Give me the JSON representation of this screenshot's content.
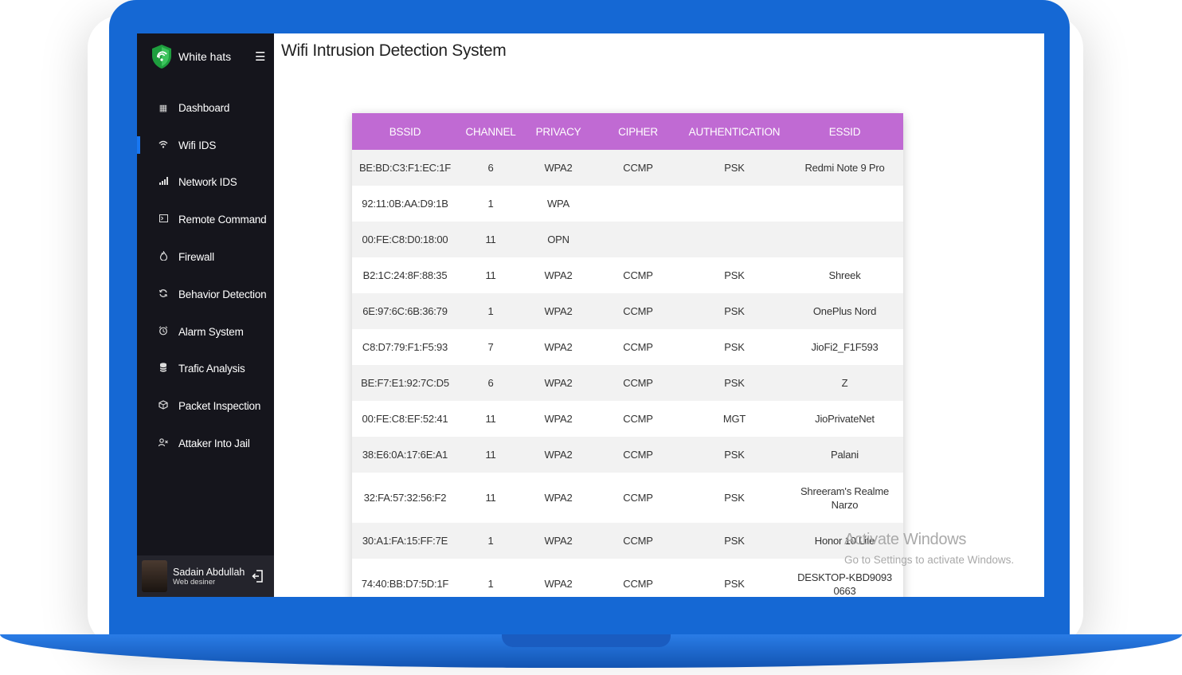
{
  "brand": {
    "name": "White hats"
  },
  "sidebar": {
    "items": [
      {
        "label": "Dashboard",
        "icon": "grid-icon"
      },
      {
        "label": "Wifi IDS",
        "icon": "wifi-icon"
      },
      {
        "label": "Network IDS",
        "icon": "signal-bars-icon"
      },
      {
        "label": "Remote Command",
        "icon": "terminal-icon"
      },
      {
        "label": "Firewall",
        "icon": "fire-icon"
      },
      {
        "label": "Behavior Detection",
        "icon": "sync-icon"
      },
      {
        "label": "Alarm System",
        "icon": "alarm-clock-icon"
      },
      {
        "label": "Trafic Analysis",
        "icon": "stack-icon"
      },
      {
        "label": "Packet Inspection",
        "icon": "cube-icon"
      },
      {
        "label": "Attaker Into Jail",
        "icon": "user-x-icon"
      }
    ],
    "active_item": "Wifi IDS"
  },
  "user": {
    "name": "Sadain Abdullah",
    "role": "Web desiner"
  },
  "page": {
    "title": "Wifi Intrusion Detection System"
  },
  "table": {
    "headers": [
      "BSSID",
      "CHANNEL",
      "PRIVACY",
      "CIPHER",
      "AUTHENTICATION",
      "ESSID"
    ],
    "rows": [
      [
        "BE:BD:C3:F1:EC:1F",
        "6",
        "WPA2",
        "CCMP",
        "PSK",
        "Redmi Note 9 Pro"
      ],
      [
        "92:11:0B:AA:D9:1B",
        "1",
        "WPA",
        "",
        "",
        ""
      ],
      [
        "00:FE:C8:D0:18:00",
        "11",
        "OPN",
        "",
        "",
        ""
      ],
      [
        "B2:1C:24:8F:88:35",
        "11",
        "WPA2",
        "CCMP",
        "PSK",
        "Shreek"
      ],
      [
        "6E:97:6C:6B:36:79",
        "1",
        "WPA2",
        "CCMP",
        "PSK",
        "OnePlus Nord"
      ],
      [
        "C8:D7:79:F1:F5:93",
        "7",
        "WPA2",
        "CCMP",
        "PSK",
        "JioFi2_F1F593"
      ],
      [
        "BE:F7:E1:92:7C:D5",
        "6",
        "WPA2",
        "CCMP",
        "PSK",
        "Z"
      ],
      [
        "00:FE:C8:EF:52:41",
        "11",
        "WPA2",
        "CCMP",
        "MGT",
        "JioPrivateNet"
      ],
      [
        "38:E6:0A:17:6E:A1",
        "11",
        "WPA2",
        "CCMP",
        "PSK",
        "Palani"
      ],
      [
        "32:FA:57:32:56:F2",
        "11",
        "WPA2",
        "CCMP",
        "PSK",
        "Shreeram's Realme Narzo"
      ],
      [
        "30:A1:FA:15:FF:7E",
        "1",
        "WPA2",
        "CCMP",
        "PSK",
        "Honor 10 Lite"
      ],
      [
        "74:40:BB:D7:5D:1F",
        "1",
        "WPA2",
        "CCMP",
        "PSK",
        "DESKTOP-KBD9093 0663"
      ]
    ]
  },
  "watermark": {
    "line1": "Activate Windows",
    "line2": "Go to Settings to activate Windows."
  },
  "colors": {
    "sidebar_bg": "#15151c",
    "header_purple": "#c06ad3",
    "laptop_blue": "#1568d4",
    "active_indicator": "#1877f2"
  }
}
